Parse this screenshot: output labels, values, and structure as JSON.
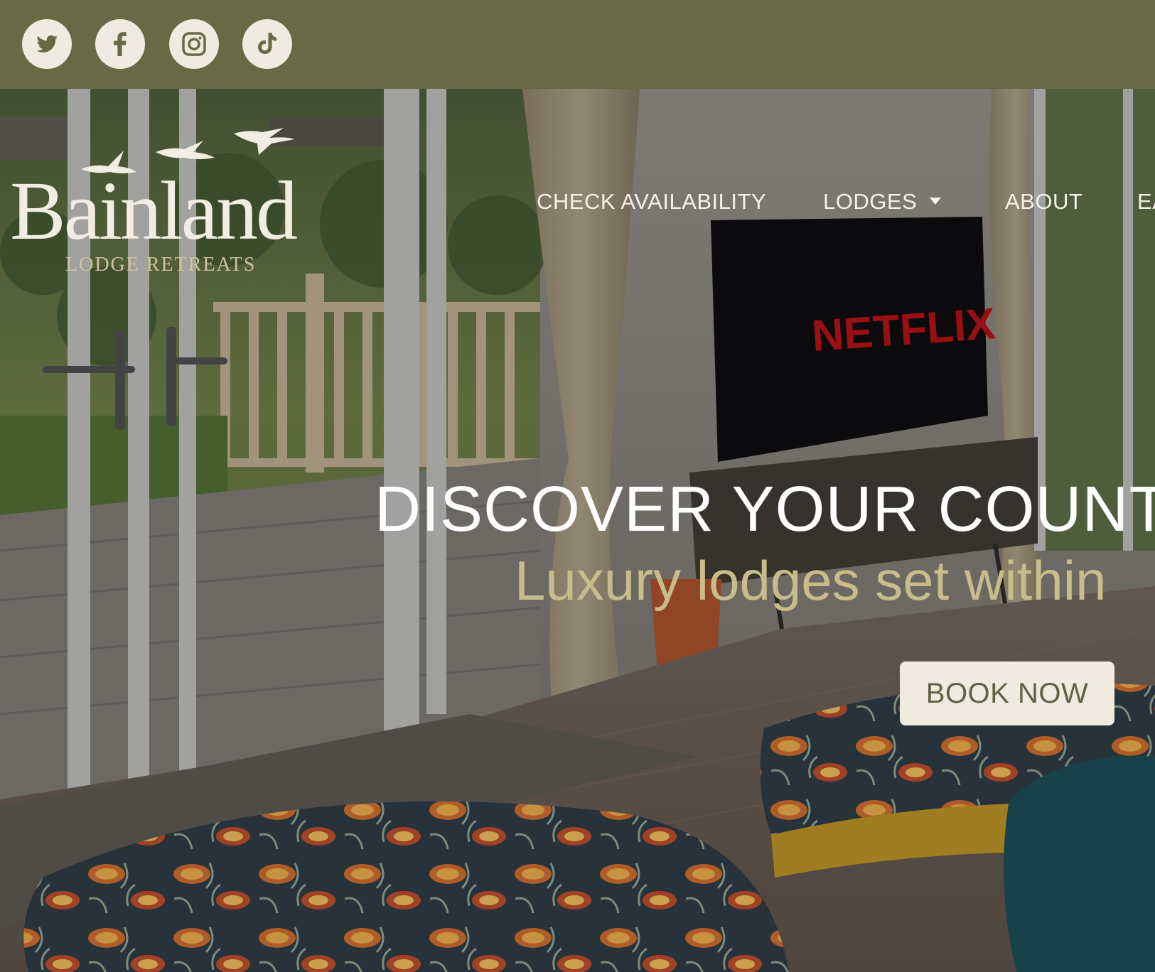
{
  "social": {
    "items": [
      {
        "name": "twitter",
        "icon": "twitter-icon"
      },
      {
        "name": "facebook",
        "icon": "facebook-icon"
      },
      {
        "name": "instagram",
        "icon": "instagram-icon"
      },
      {
        "name": "tiktok",
        "icon": "tiktok-icon"
      }
    ]
  },
  "logo": {
    "name": "Bainland",
    "tagline": "LODGE RETREATS",
    "icon": "birds-logo-icon"
  },
  "nav": {
    "check_availability": "CHECK AVAILABILITY",
    "lodges": "LODGES",
    "lodges_icon": "caret-down-icon",
    "about": "ABOUT",
    "partial": "EA"
  },
  "hero": {
    "headline": "DISCOVER YOUR COUNT",
    "subline": "Luxury lodges set within",
    "cta": "BOOK NOW",
    "tv_brand": "NETFLIX"
  },
  "colors": {
    "topbar": "#676a45",
    "icon_bg": "#efebe0",
    "accent_gold": "#c8bc8a",
    "button_text": "#5f6244"
  }
}
